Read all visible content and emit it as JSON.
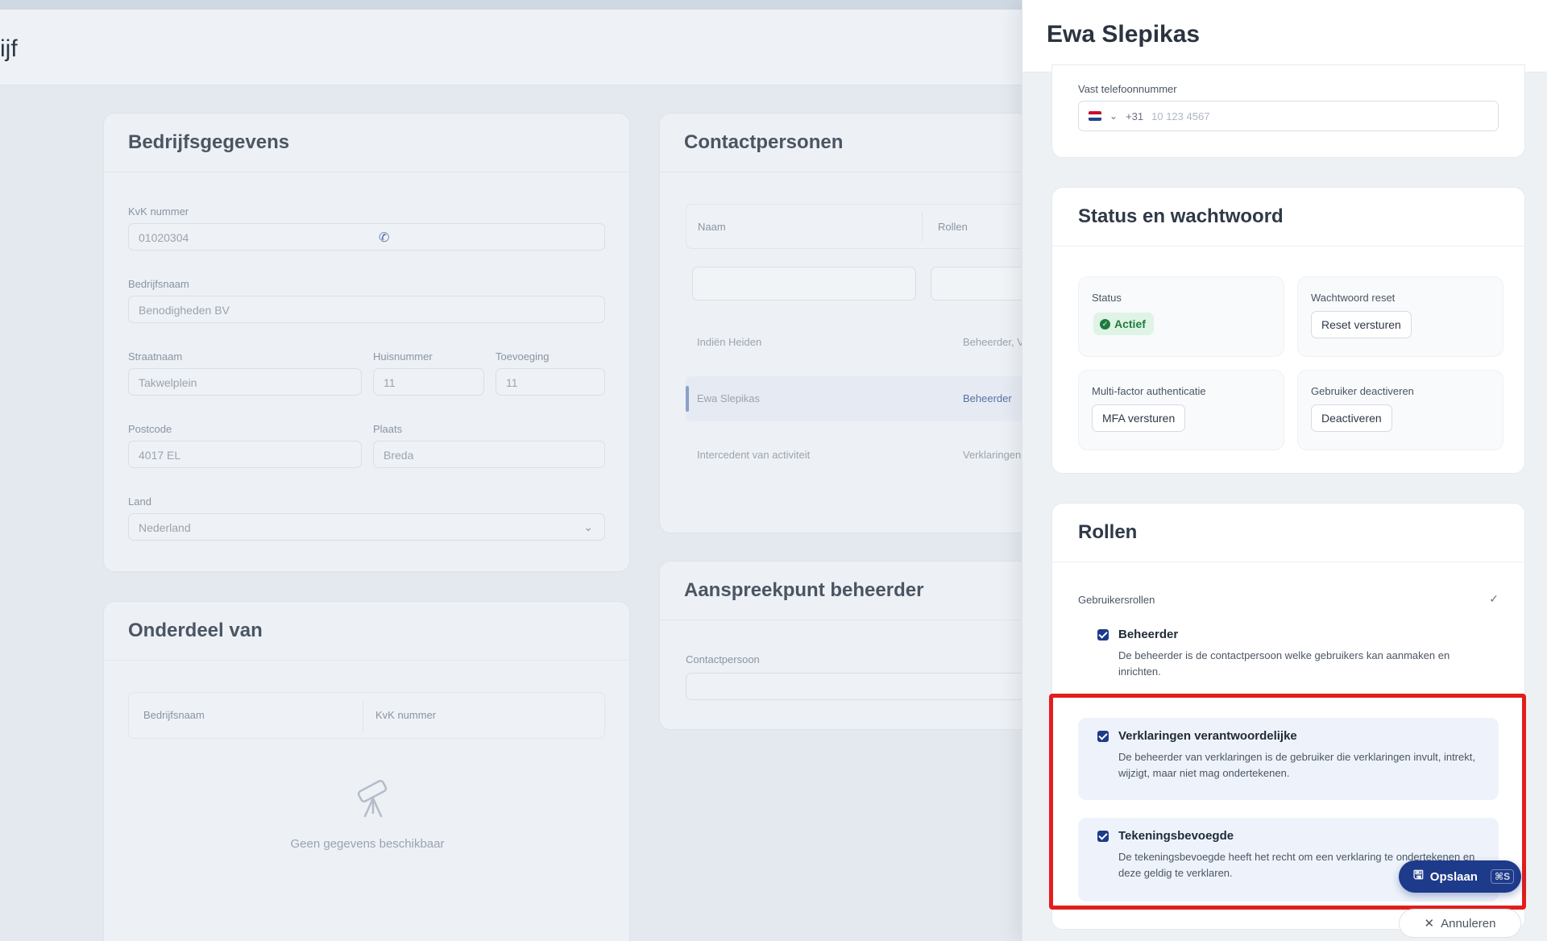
{
  "page": {
    "title": "ijf"
  },
  "bedrijfsgegevens": {
    "title": "Bedrijfsgegevens",
    "kvk_label": "KvK nummer",
    "kvk_value": "01020304",
    "bedrijfsnaam_label": "Bedrijfsnaam",
    "bedrijfsnaam_value": "Benodigheden BV",
    "straat_label": "Straatnaam",
    "straat_value": "Takwelplein",
    "huisnummer_label": "Huisnummer",
    "huisnummer_value": "11",
    "toevoeging_label": "Toevoeging",
    "toevoeging_value": "11",
    "postcode_label": "Postcode",
    "postcode_value": "4017 EL",
    "plaats_label": "Plaats",
    "plaats_value": "Breda",
    "land_label": "Land",
    "land_value": "Nederland"
  },
  "onderdeel": {
    "title": "Onderdeel van",
    "col_bedrijfsnaam": "Bedrijfsnaam",
    "col_kvk": "KvK nummer",
    "empty_text": "Geen gegevens beschikbaar"
  },
  "contactpersonen": {
    "title": "Contactpersonen",
    "col_naam": "Naam",
    "col_rollen": "Rollen",
    "rows": [
      {
        "naam": "Indiën Heiden",
        "rol": "Beheerder, Verk"
      },
      {
        "naam": "Ewa Slepikas",
        "rol": "Beheerder"
      },
      {
        "naam": "Intercedent van activiteit",
        "rol": "Verklaringen ve"
      }
    ]
  },
  "aanspreekpunt": {
    "title": "Aanspreekpunt beheerder",
    "contact_label": "Contactpersoon"
  },
  "panel": {
    "title": "Ewa Slepikas",
    "phone_label": "Vast telefoonnummer",
    "phone_prefix": "+31",
    "phone_placeholder": "10 123 4567",
    "status_card": {
      "title": "Status en wachtwoord",
      "status_label": "Status",
      "status_value": "Actief",
      "reset_label": "Wachtwoord reset",
      "reset_button": "Reset versturen",
      "mfa_label": "Multi-factor authenticatie",
      "mfa_button": "MFA versturen",
      "deactivate_label": "Gebruiker deactiveren",
      "deactivate_button": "Deactiveren"
    },
    "rollen_card": {
      "title": "Rollen",
      "group_label": "Gebruikersrollen",
      "roles": [
        {
          "name": "Beheerder",
          "desc": "De beheerder is de contactpersoon welke gebruikers kan aanmaken en inrichten."
        },
        {
          "name": "Verklaringen verantwoordelijke",
          "desc": "De beheerder van verklaringen is de gebruiker die verklaringen invult, intrekt, wijzigt, maar niet mag ondertekenen."
        },
        {
          "name": "Tekeningsbevoegde",
          "desc": "De tekeningsbevoegde heeft het recht om een verklaring te ondertekenen en deze geldig te verklaren."
        }
      ]
    },
    "save_label": "Opslaan",
    "save_shortcut": "⌘S",
    "cancel_label": "Annuleren"
  },
  "colors": {
    "accent": "#1e3a8a",
    "success": "#1f7a3e",
    "highlight": "#e21d1d"
  }
}
